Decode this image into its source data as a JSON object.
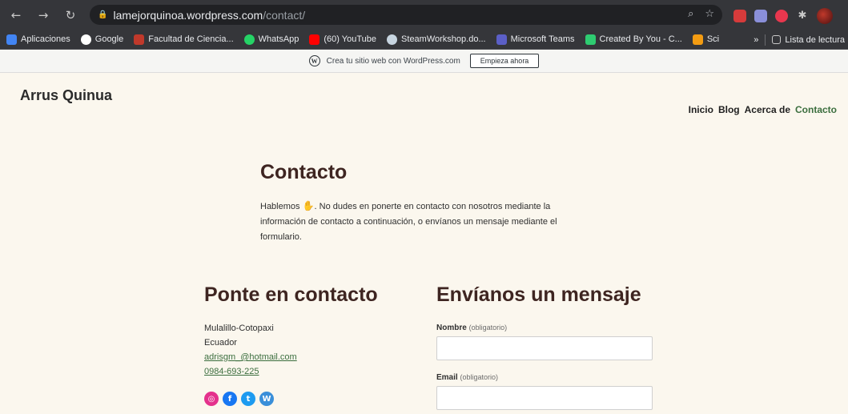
{
  "browser": {
    "url_host": "lamejorquinoa.wordpress.com",
    "url_path": "/contact/",
    "bookmarks": [
      {
        "label": "Aplicaciones",
        "color": "#4285f4"
      },
      {
        "label": "Google",
        "color": "#ffffff"
      },
      {
        "label": "Facultad de Ciencia...",
        "color": "#c0392b"
      },
      {
        "label": "WhatsApp",
        "color": "#25d366"
      },
      {
        "label": "(60) YouTube",
        "color": "#ff0000"
      },
      {
        "label": "SteamWorkshop.do...",
        "color": "#c7d5e0"
      },
      {
        "label": "Microsoft Teams",
        "color": "#5b5fc7"
      },
      {
        "label": "Created By You - C...",
        "color": "#2ecc71"
      },
      {
        "label": "Sci",
        "color": "#f39c12"
      }
    ],
    "more_bookmarks": "»",
    "reading_list": "Lista de lectura"
  },
  "wp_banner": {
    "text": "Crea tu sitio web con WordPress.com",
    "button": "Empieza ahora"
  },
  "site": {
    "title": "Arrus Quinua",
    "nav": [
      "Inicio",
      "Blog",
      "Acerca de",
      "Contacto"
    ]
  },
  "page": {
    "heading": "Contacto",
    "intro_before": "Hablemos ",
    "intro_after": ". No dudes en ponerte en contacto con nosotros mediante la información de contacto a continuación, o envíanos un mensaje mediante el formulario.",
    "left_title": "Ponte en contacto",
    "right_title": "Envíanos un mensaje",
    "address_line1": "Mulalillo-Cotopaxi",
    "address_line2": "Ecuador",
    "email": "adrisgm_@hotmail.com",
    "phone": "0984-693-225",
    "form": {
      "name_label": "Nombre",
      "name_req": "(obligatorio)",
      "email_label": "Email",
      "email_req": "(obligatorio)"
    }
  },
  "colors": {
    "accent_green": "#3b6e3e",
    "heading_brown": "#3e2521",
    "page_bg": "#fbf7ee"
  }
}
